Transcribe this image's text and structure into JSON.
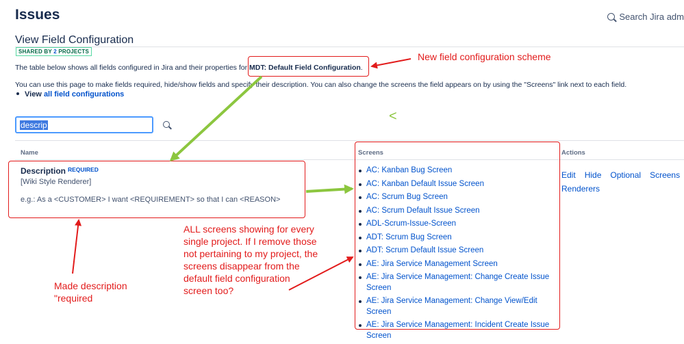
{
  "header": {
    "title": "Issues",
    "search_label": "Search Jira adm"
  },
  "page": {
    "title": "View Field Configuration",
    "shared_badge_prefix": "SHARED BY",
    "shared_badge_count": "2",
    "shared_badge_suffix": "PROJECTS",
    "description_prefix": "The table below shows all fields configured in Jira and their properties for",
    "config_name": "MDT: Default Field Configuration",
    "description_suffix": ".",
    "info_text": "You can use this page to make fields required, hide/show fields and specify their description. You can also change the screens the field appears on by using the \"Screens\" link next to each field.",
    "view_label": "View",
    "view_link": "all field configurations"
  },
  "filter": {
    "value": "descrip"
  },
  "table": {
    "columns": [
      "Name",
      "Screens",
      "Actions"
    ],
    "row": {
      "name": "Description",
      "badge": "REQUIRED",
      "renderer": "[Wiki Style Renderer]",
      "help": "e.g.: As a <CUSTOMER> I want <REQUIREMENT> so that I can <REASON>",
      "screens": [
        "AC: Kanban Bug Screen",
        "AC: Kanban Default Issue Screen",
        "AC: Scrum Bug Screen",
        "AC: Scrum Default Issue Screen",
        "ADL-Scrum-Issue-Screen",
        "ADT: Scrum Bug Screen",
        "ADT: Scrum Default Issue Screen",
        "AE: Jira Service Management Screen",
        "AE: Jira Service Management: Change Create Issue Screen",
        "AE: Jira Service Management: Change View/Edit Screen",
        "AE: Jira Service Management: Incident Create Issue Screen"
      ],
      "actions": [
        "Edit",
        "Hide",
        "Optional",
        "Screens",
        "Renderers"
      ]
    }
  },
  "annotations": {
    "scheme_note": "New field configuration scheme",
    "required_note": "Made description \"required",
    "screens_note": "ALL screens showing for every single project. If I remove those not pertaining to my project, the screens disappear from the default field configuration screen too?",
    "stray_mark": "<"
  },
  "colors": {
    "link": "#0052cc",
    "annotation_red": "#e21b1b",
    "annotation_green": "#8cc63f",
    "badge_green": "#006644"
  },
  "icons": [
    "search-icon",
    "bullet-icon"
  ]
}
